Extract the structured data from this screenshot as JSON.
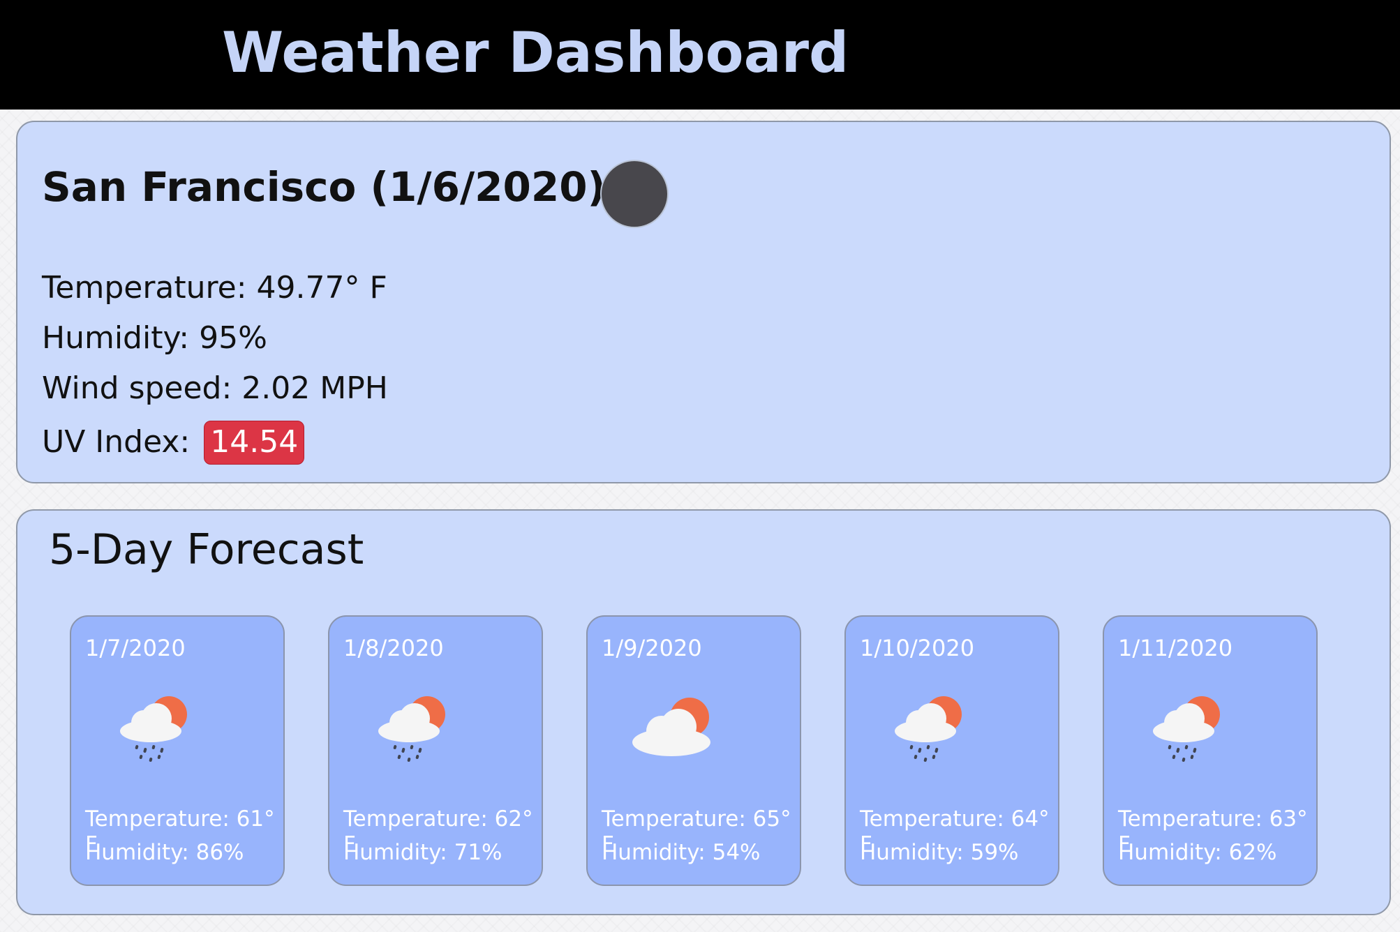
{
  "header": {
    "title": "Weather Dashboard"
  },
  "current": {
    "city_title": "San Francisco (1/6/2020)",
    "icon": "dark-circle-weather-icon",
    "temperature": "Temperature: 49.77° F",
    "humidity": "Humidity: 95%",
    "wind": "Wind speed: 2.02 MPH",
    "uv_label": "UV Index: ",
    "uv_value": "14.54",
    "uv_color": "#dc3545"
  },
  "forecast": {
    "heading": "5-Day Forecast",
    "days": [
      {
        "date": "1/7/2020",
        "icon": "rain-cloud-sun-icon",
        "temperature": "Temperature: 61° F",
        "humidity": "Humidity: 86%"
      },
      {
        "date": "1/8/2020",
        "icon": "rain-cloud-sun-icon",
        "temperature": "Temperature: 62° F",
        "humidity": "Humidity: 71%"
      },
      {
        "date": "1/9/2020",
        "icon": "cloud-sun-icon",
        "temperature": "Temperature: 65° F",
        "humidity": "Humidity: 54%"
      },
      {
        "date": "1/10/2020",
        "icon": "rain-cloud-sun-icon",
        "temperature": "Temperature: 64° F",
        "humidity": "Humidity: 59%"
      },
      {
        "date": "1/11/2020",
        "icon": "rain-cloud-sun-icon",
        "temperature": "Temperature: 63° F",
        "humidity": "Humidity: 62%"
      }
    ]
  },
  "colors": {
    "header_bg": "#000000",
    "header_text": "#c5d4f7",
    "card_bg": "#cbdafc",
    "day_card_bg": "#98b4fc",
    "sun": "#ef6d47",
    "cloud": "#f5f5f5"
  }
}
